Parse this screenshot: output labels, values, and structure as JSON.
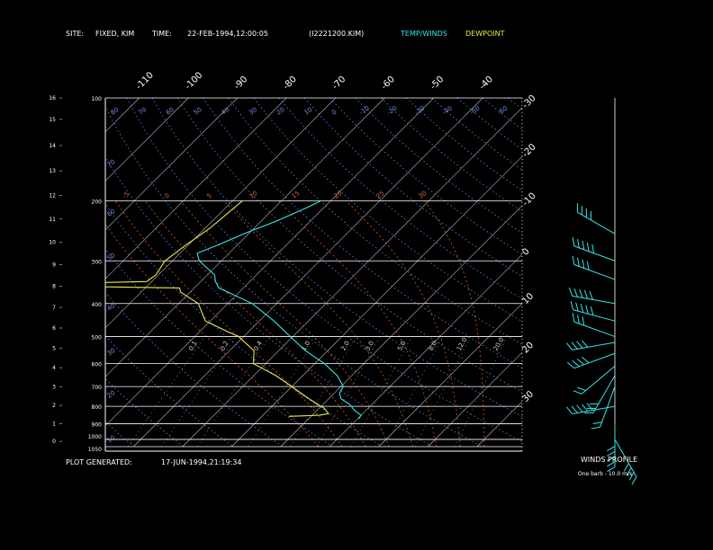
{
  "header": {
    "site_label": "SITE:",
    "site_value": "FIXED, KIM",
    "time_label": "TIME:",
    "time_value": "22-FEB-1994,12:00:05",
    "file_value": "(I2221200.KIM)",
    "legend_temp": "TEMP/WINDS",
    "legend_dew": "DEWPOINT"
  },
  "footer": {
    "generated_label": "PLOT GENERATED:",
    "generated_value": "17-JUN-1994,21:19:34"
  },
  "wind_panel": {
    "title": "WINDS PROFILE",
    "note": "One barb - 10.0 m/s"
  },
  "colors": {
    "background": "#000000",
    "frame": "#ffffff",
    "temperature": "#33e6e6",
    "dewpoint": "#e8e84a",
    "dry_adiabat": "#5a78e0",
    "moist_adiabat": "#c0502a",
    "mixing_ratio": "#9a9a9a",
    "isotherm": "#ffffff"
  },
  "chart_data": {
    "type": "line",
    "title": "",
    "pressure_levels": [
      "100",
      "200",
      "300",
      "400",
      "500",
      "600",
      "700",
      "800",
      "900",
      "1000",
      "1050"
    ],
    "height_km_ticks": [
      "0",
      "1",
      "2",
      "3",
      "4",
      "5",
      "6",
      "7",
      "8",
      "9",
      "10",
      "11",
      "12",
      "13",
      "14",
      "15",
      "16"
    ],
    "top_temp_ticks": [
      "-110",
      "-100",
      "-90",
      "-80",
      "-70",
      "-60",
      "-50",
      "-40"
    ],
    "right_temp_ticks": [
      "-30",
      "-20",
      "-10",
      "0",
      "10",
      "20",
      "30"
    ],
    "dry_adiabat_labels": [
      "80",
      "70",
      "60",
      "50",
      "40",
      "30",
      "20",
      "10",
      "0",
      "-10",
      "-20",
      "-30",
      "-40",
      "-50",
      "-60",
      "-70"
    ],
    "dry_adiabat_left_labels": [
      "70",
      "60",
      "50",
      "40",
      "30",
      "20",
      "10",
      "0",
      "-10",
      "-20",
      "-30"
    ],
    "moist_adiabat_labels": [
      "-5",
      "0",
      "5",
      "10",
      "15",
      "20",
      "25",
      "30"
    ],
    "moist_adiabat_values": [
      -5,
      0,
      5,
      10,
      15,
      20,
      25,
      30
    ],
    "mixing_ratio_labels": [
      "0.1",
      "0.2",
      "0.4",
      "1.0",
      "2.0",
      "3.0",
      "5.0",
      "8.0",
      "12.0",
      "20.0"
    ],
    "mixing_ratio_values": [
      0.1,
      0.2,
      0.4,
      1.0,
      2.0,
      3.0,
      5.0,
      8.0,
      12.0,
      20.0
    ],
    "ylim_hPa": [
      1050,
      100
    ],
    "xlim_temp_C_at_1050": [
      -45,
      40
    ],
    "series": [
      {
        "name": "TEMP/WINDS",
        "points": [
          [
            200,
            -52.0
          ],
          [
            210,
            -53.5
          ],
          [
            230,
            -57.0
          ],
          [
            250,
            -61.0
          ],
          [
            270,
            -64.0
          ],
          [
            285,
            -66.5
          ],
          [
            300,
            -64.5
          ],
          [
            330,
            -58.5
          ],
          [
            345,
            -57.0
          ],
          [
            360,
            -55.0
          ],
          [
            400,
            -45.0
          ],
          [
            450,
            -37.0
          ],
          [
            500,
            -30.5
          ],
          [
            550,
            -24.5
          ],
          [
            600,
            -18.0
          ],
          [
            650,
            -13.0
          ],
          [
            700,
            -9.5
          ],
          [
            730,
            -9.0
          ],
          [
            760,
            -7.5
          ],
          [
            790,
            -4.5
          ],
          [
            820,
            -2.5
          ],
          [
            850,
            0.0
          ],
          [
            870,
            0.2
          ]
        ]
      },
      {
        "name": "DEWPOINT",
        "points": [
          [
            200,
            -68.0
          ],
          [
            240,
            -69.0
          ],
          [
            270,
            -70.5
          ],
          [
            300,
            -71.5
          ],
          [
            330,
            -70.5
          ],
          [
            345,
            -71.0
          ],
          [
            350,
            -91.0
          ],
          [
            356,
            -87.0
          ],
          [
            360,
            -63.0
          ],
          [
            370,
            -62.0
          ],
          [
            400,
            -56.0
          ],
          [
            450,
            -51.0
          ],
          [
            480,
            -45.0
          ],
          [
            500,
            -41.0
          ],
          [
            550,
            -35.0
          ],
          [
            600,
            -32.5
          ],
          [
            650,
            -25.5
          ],
          [
            700,
            -20.0
          ],
          [
            730,
            -17.0
          ],
          [
            760,
            -14.0
          ],
          [
            790,
            -11.0
          ],
          [
            810,
            -9.0
          ],
          [
            840,
            -7.0
          ],
          [
            850,
            -8.5
          ],
          [
            856,
            -14.5
          ]
        ]
      }
    ],
    "winds": [
      {
        "p": 250,
        "dir": 300,
        "spd": 40
      },
      {
        "p": 300,
        "dir": 290,
        "spd": 45
      },
      {
        "p": 340,
        "dir": 290,
        "spd": 40
      },
      {
        "p": 400,
        "dir": 280,
        "spd": 45
      },
      {
        "p": 450,
        "dir": 285,
        "spd": 45
      },
      {
        "p": 500,
        "dir": 290,
        "spd": 30
      },
      {
        "p": 520,
        "dir": 260,
        "spd": 40
      },
      {
        "p": 560,
        "dir": 250,
        "spd": 40
      },
      {
        "p": 610,
        "dir": 230,
        "spd": 20
      },
      {
        "p": 650,
        "dir": 210,
        "spd": 25
      },
      {
        "p": 700,
        "dir": 200,
        "spd": 20
      },
      {
        "p": 800,
        "dir": 260,
        "spd": 60
      },
      {
        "p": 900,
        "dir": 180,
        "spd": 50
      },
      {
        "p": 1000,
        "dir": 150,
        "spd": 40
      }
    ]
  }
}
